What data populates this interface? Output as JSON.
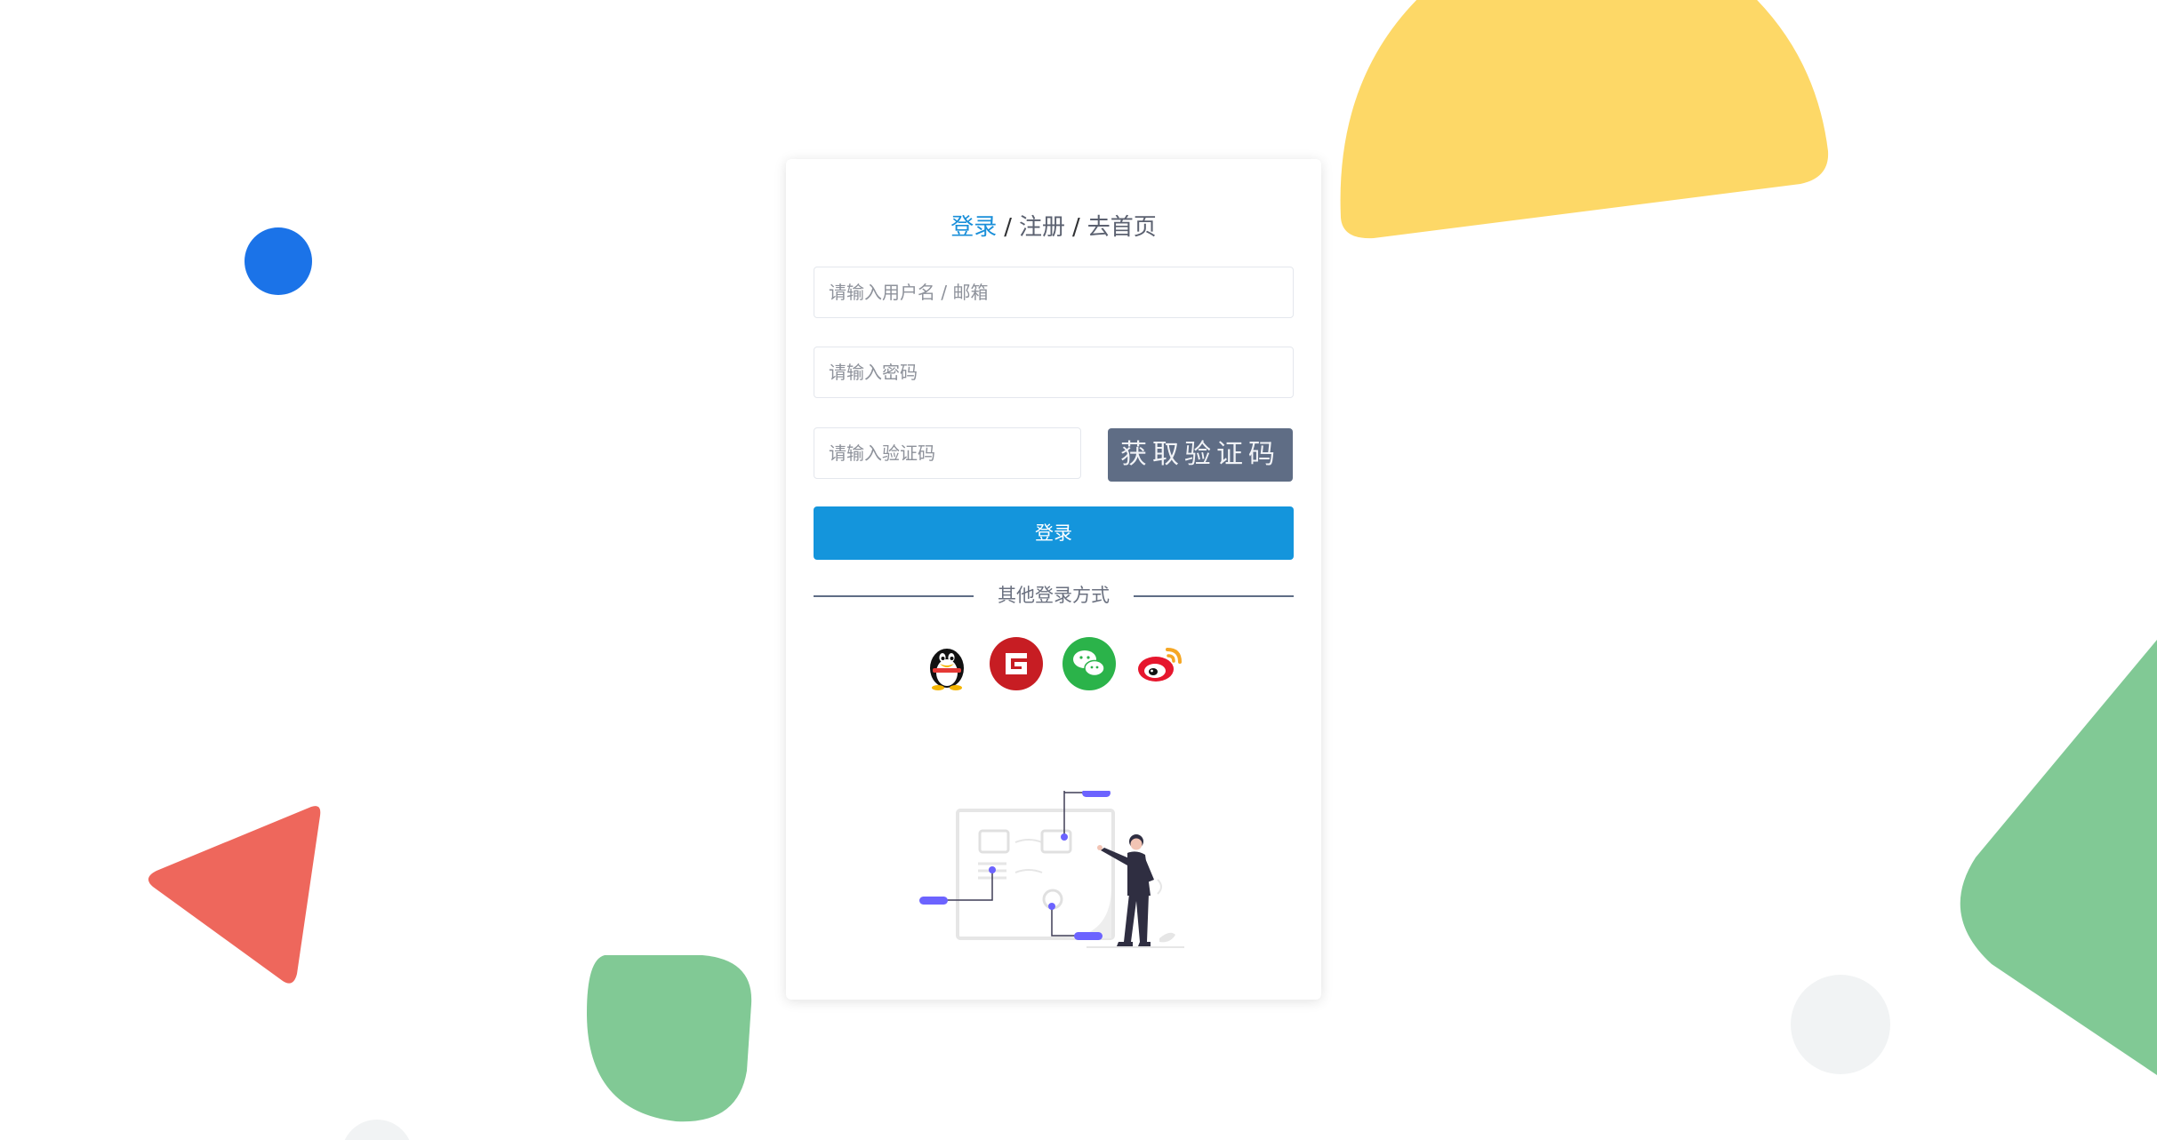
{
  "tabs": {
    "login": "登录",
    "separator": "/",
    "register": "注册",
    "home": "去首页"
  },
  "form": {
    "username_placeholder": "请输入用户名 / 邮箱",
    "password_placeholder": "请输入密码",
    "captcha_placeholder": "请输入验证码",
    "captcha_button": "获取验证码",
    "login_button": "登录"
  },
  "other_login": {
    "label": "其他登录方式",
    "providers": [
      "qq-icon",
      "gitee-icon",
      "wechat-icon",
      "weibo-icon"
    ]
  },
  "colors": {
    "accent": "#1495dc",
    "captcha_bg": "#5f6d85",
    "yellow_shape": "#fdd867",
    "blue_dot": "#1b73e8",
    "red_triangle": "#ee675c",
    "green_shape": "#81c995"
  }
}
